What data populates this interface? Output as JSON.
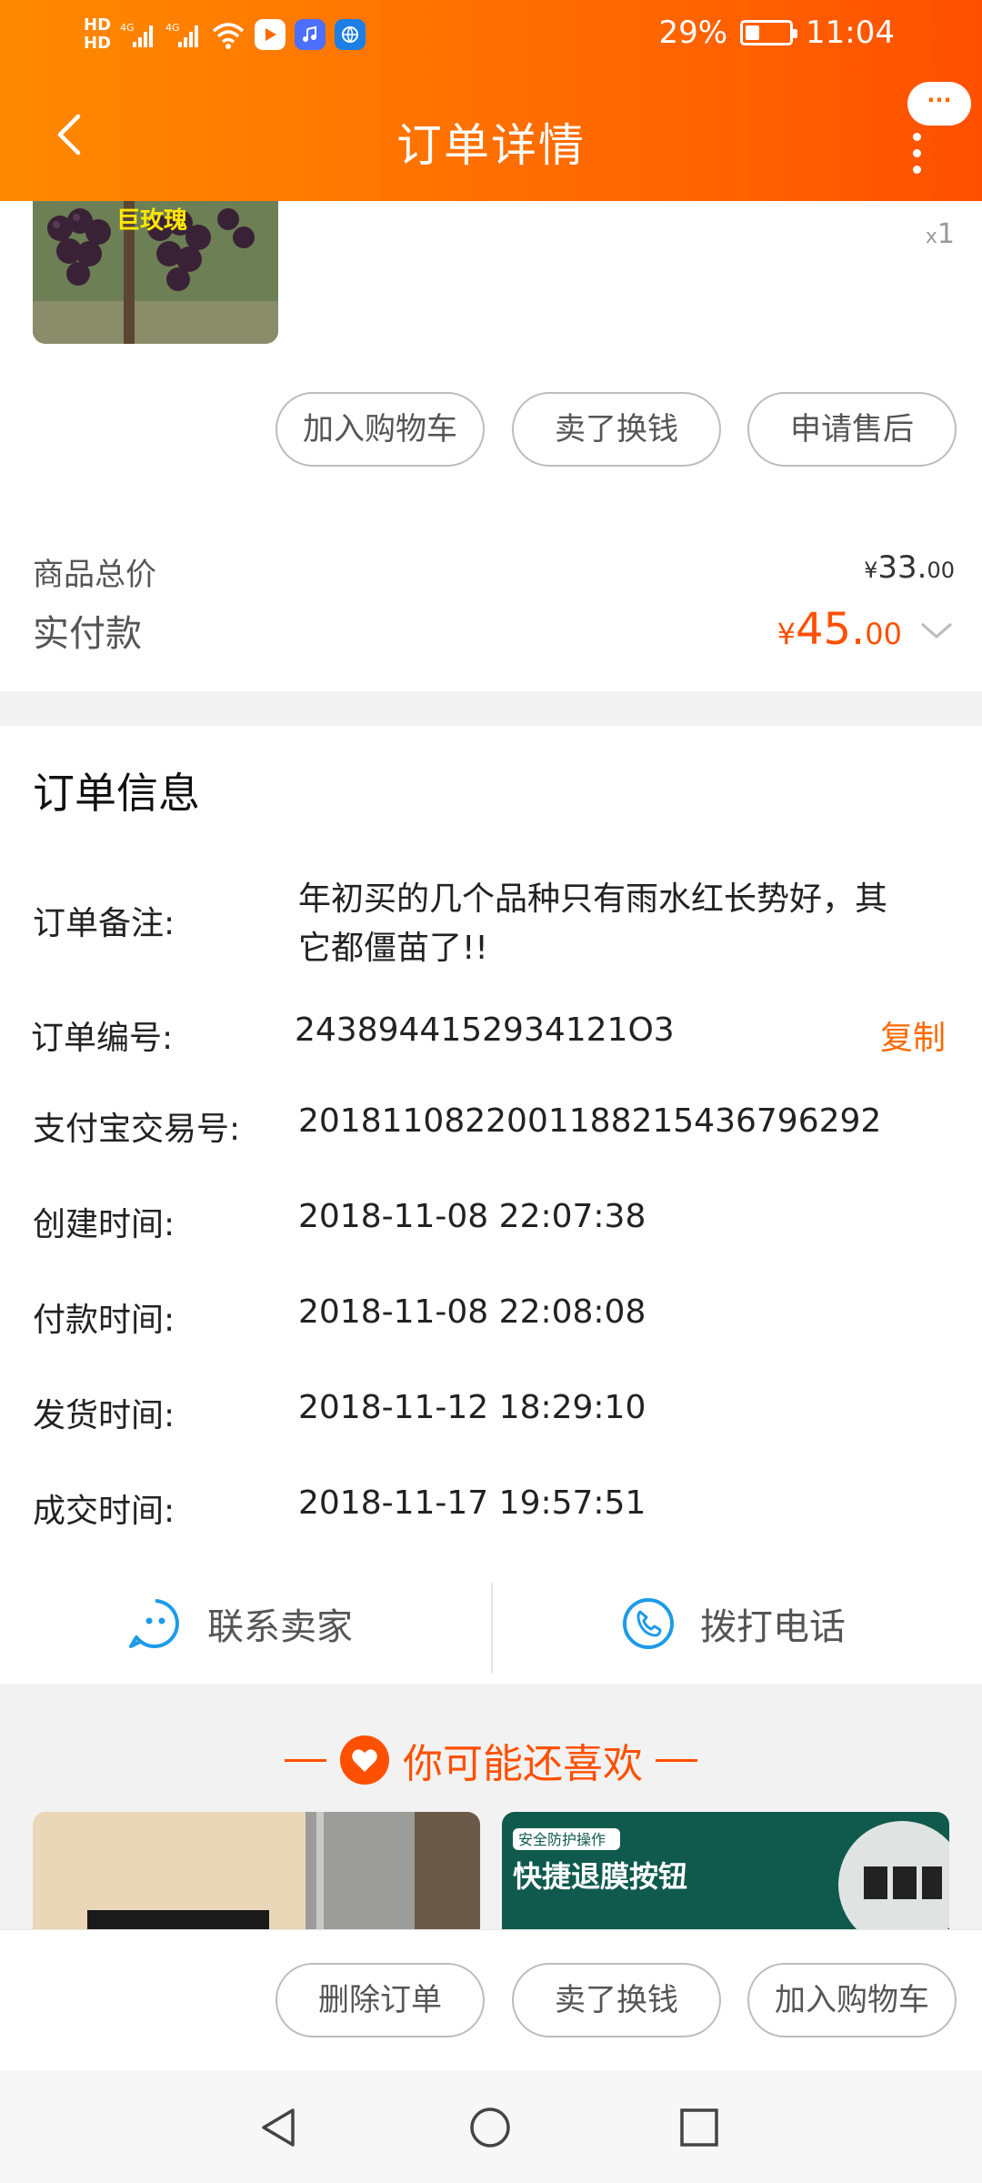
{
  "status_bar": {
    "hd1": "HD",
    "hd2": "HD",
    "net1": "4G",
    "net2": "4G",
    "battery_text": "29%",
    "battery_level": 0.29,
    "time": "11:04"
  },
  "nav": {
    "title": "订单详情",
    "more_bubble": "···"
  },
  "product": {
    "image_caption": "巨玫瑰",
    "qty_prefix": "x",
    "qty": "1"
  },
  "item_actions": [
    "加入购物车",
    "卖了换钱",
    "申请售后"
  ],
  "prices": {
    "total_label": "商品总价",
    "total_symbol": "¥",
    "total_int": "33.",
    "total_dec": "00",
    "paid_label": "实付款",
    "paid_symbol": "¥",
    "paid_int": "45.",
    "paid_dec": "00"
  },
  "order_info": {
    "title": "订单信息",
    "note_label": "订单备注:",
    "note_line1": "年初买的几个品种只有雨水红长势好，其",
    "note_line2": "它都僵苗了!!",
    "order_no_label": "订单编号:",
    "order_no": "2438944152934121O3",
    "copy_label": "复制",
    "alipay_label": "支付宝交易号:",
    "alipay_no": "2018110822001188215436796292",
    "created_label": "创建时间:",
    "created": "2018-11-08 22:07:38",
    "paid_label": "付款时间:",
    "paid": "2018-11-08 22:08:08",
    "shipped_label": "发货时间:",
    "shipped": "2018-11-12 18:29:10",
    "done_label": "成交时间:",
    "done": "2018-11-17 19:57:51"
  },
  "contact": {
    "seller": "联系卖家",
    "call": "拨打电话"
  },
  "recommend": {
    "title": "你可能还喜欢",
    "card2_tag": "安全防护操作",
    "card2_title": "快捷退膜按钮"
  },
  "bottom_actions": [
    "删除订单",
    "卖了换钱",
    "加入购物车"
  ]
}
